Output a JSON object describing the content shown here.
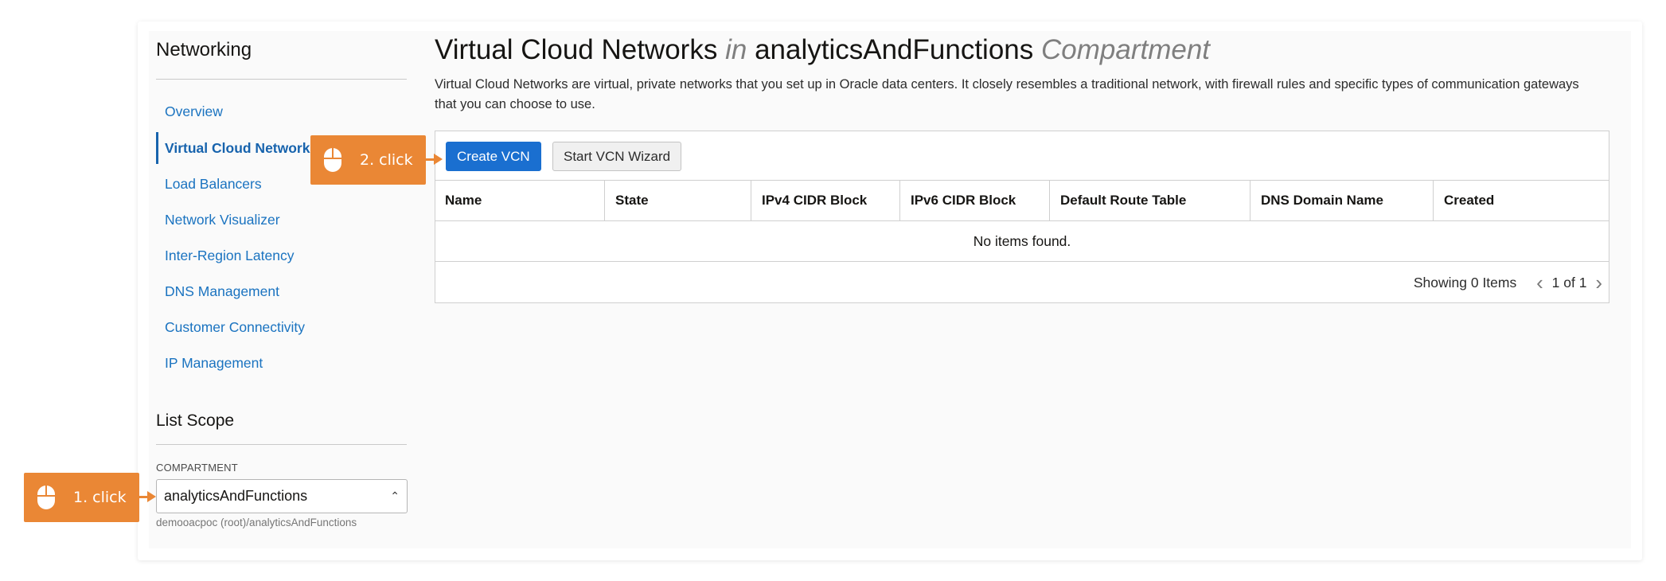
{
  "sidebar": {
    "title": "Networking",
    "items": [
      {
        "label": "Overview"
      },
      {
        "label": "Virtual Cloud Networks"
      },
      {
        "label": "Load Balancers"
      },
      {
        "label": "Network Visualizer"
      },
      {
        "label": "Inter-Region Latency"
      },
      {
        "label": "DNS Management"
      },
      {
        "label": "Customer Connectivity"
      },
      {
        "label": "IP Management"
      }
    ],
    "scope": {
      "title": "List Scope",
      "compartment_label": "COMPARTMENT",
      "compartment_value": "analyticsAndFunctions",
      "compartment_path": "demooacpoc (root)/analyticsAndFunctions"
    }
  },
  "main": {
    "title_main": "Virtual Cloud Networks",
    "title_in": "in",
    "title_compartment": "analyticsAndFunctions",
    "title_suffix": "Compartment",
    "description": "Virtual Cloud Networks are virtual, private networks that you set up in Oracle data centers. It closely resembles a traditional network, with firewall rules and specific types of communication gateways that you can choose to use.",
    "buttons": {
      "create": "Create VCN",
      "wizard": "Start VCN Wizard"
    },
    "table": {
      "columns": [
        "Name",
        "State",
        "IPv4 CIDR Block",
        "IPv6 CIDR Block",
        "Default Route Table",
        "DNS Domain Name",
        "Created"
      ],
      "empty_text": "No items found."
    },
    "pager": {
      "showing": "Showing 0 Items",
      "page": "1 of 1"
    }
  },
  "callouts": [
    {
      "label": "1. click"
    },
    {
      "label": "2. click"
    }
  ],
  "colors": {
    "accent": "#ea8735",
    "primary": "#1a6fd0",
    "link": "#1a73c0"
  }
}
